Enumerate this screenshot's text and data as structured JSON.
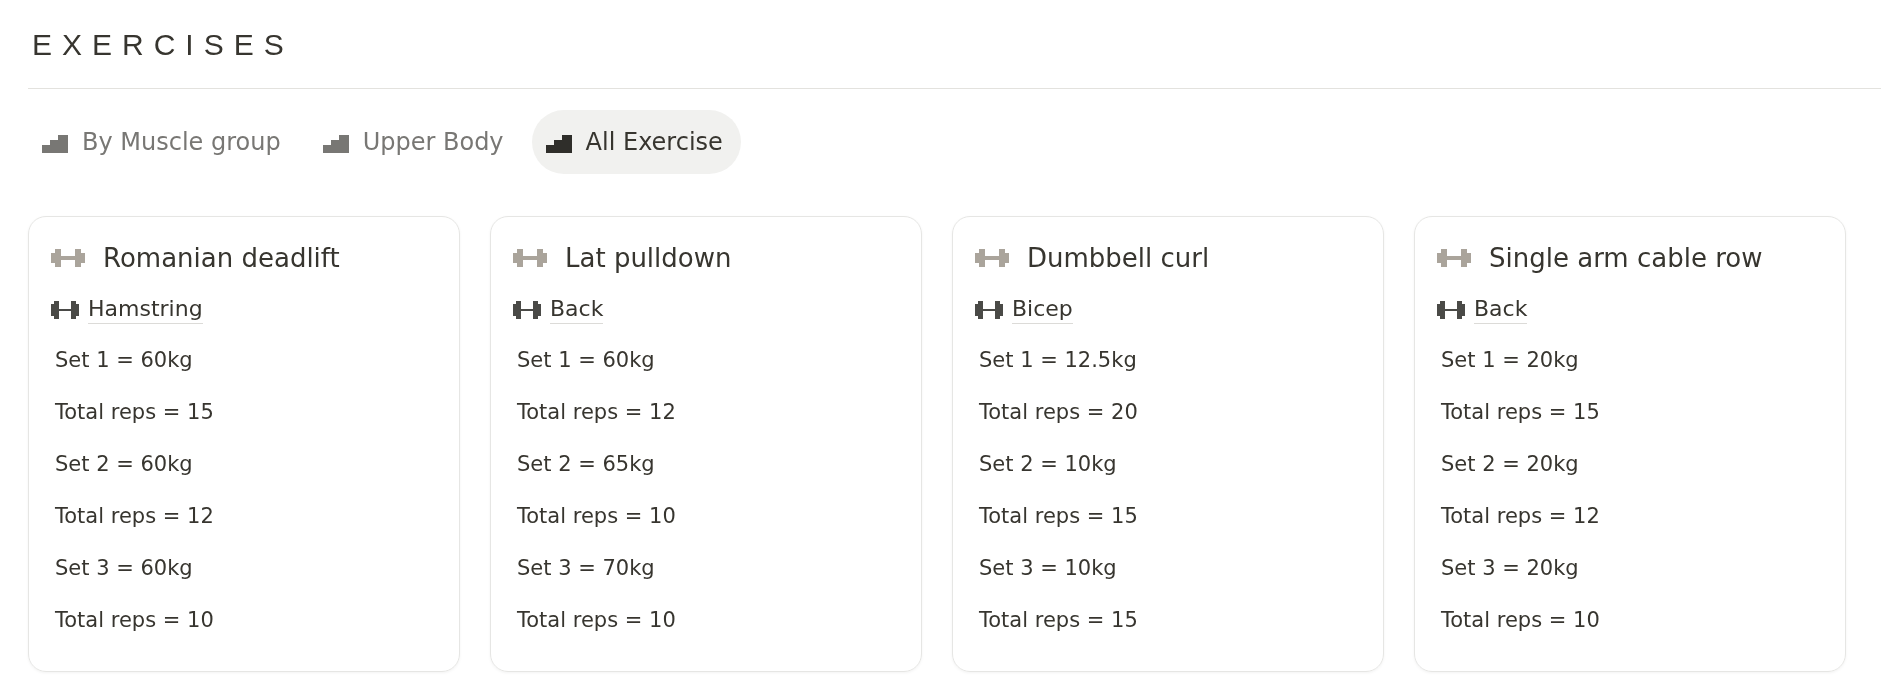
{
  "page_title": "EXERCISES",
  "tabs": [
    {
      "label": "By Muscle group",
      "selected": false
    },
    {
      "label": "Upper Body",
      "selected": false
    },
    {
      "label": "All Exercise",
      "selected": true
    }
  ],
  "cards": [
    {
      "title": "Romanian deadlift",
      "muscle": "Hamstring",
      "lines": [
        "Set 1 = 60kg",
        "Total reps = 15",
        "Set 2 = 60kg",
        "Total reps = 12",
        "Set 3 = 60kg",
        "Total reps = 10"
      ]
    },
    {
      "title": "Lat pulldown",
      "muscle": "Back",
      "lines": [
        "Set 1 = 60kg",
        "Total reps = 12",
        "Set 2 = 65kg",
        "Total reps = 10",
        "Set 3 = 70kg",
        "Total reps = 10"
      ]
    },
    {
      "title": "Dumbbell curl",
      "muscle": "Bicep",
      "lines": [
        "Set 1 = 12.5kg",
        "Total reps = 20",
        "Set 2 = 10kg",
        "Total reps = 15",
        "Set 3 = 10kg",
        "Total reps = 15"
      ]
    },
    {
      "title": "Single arm cable row",
      "muscle": "Back",
      "lines": [
        "Set 1 = 20kg",
        "Total reps = 15",
        "Set 2 = 20kg",
        "Total reps = 12",
        "Set 3 = 20kg",
        "Total reps = 10"
      ]
    }
  ]
}
